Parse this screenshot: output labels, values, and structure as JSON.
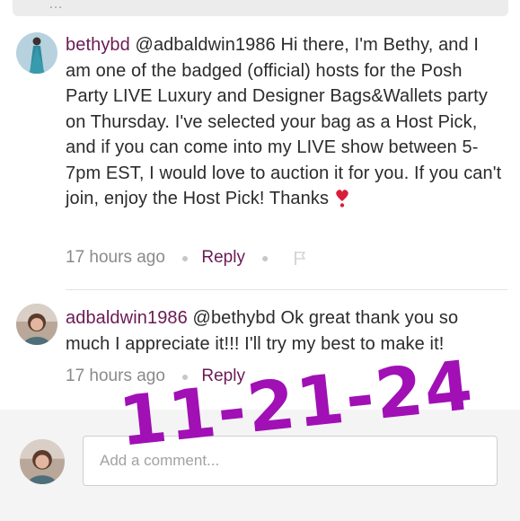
{
  "comments": [
    {
      "username": "bethybd",
      "text": "@adbaldwin1986 Hi there, I'm Bethy, and I am one of the badged (official) hosts for the Posh Party LIVE Luxury and Designer Bags&Wallets party on Thursday. I've selected your bag as a Host Pick, and if you can come into my LIVE show between 5-7pm EST, I would love to auction it for you. If you can't join, enjoy the Host Pick! Thanks",
      "emoji": "heavy-heart-exclamation",
      "time": "17 hours ago",
      "reply_label": "Reply",
      "has_flag": true
    },
    {
      "username": "adbaldwin1986",
      "text": "@bethybd Ok great thank you so much I appreciate it!!! I'll try my best to make it!",
      "time": "17 hours ago",
      "reply_label": "Reply",
      "has_flag": false
    }
  ],
  "compose": {
    "placeholder": "Add a comment..."
  },
  "overlay": {
    "date_stamp": "11-21-24",
    "color": "#a010b5"
  },
  "colors": {
    "username": "#6b1a55",
    "reply": "#6b1a55"
  }
}
